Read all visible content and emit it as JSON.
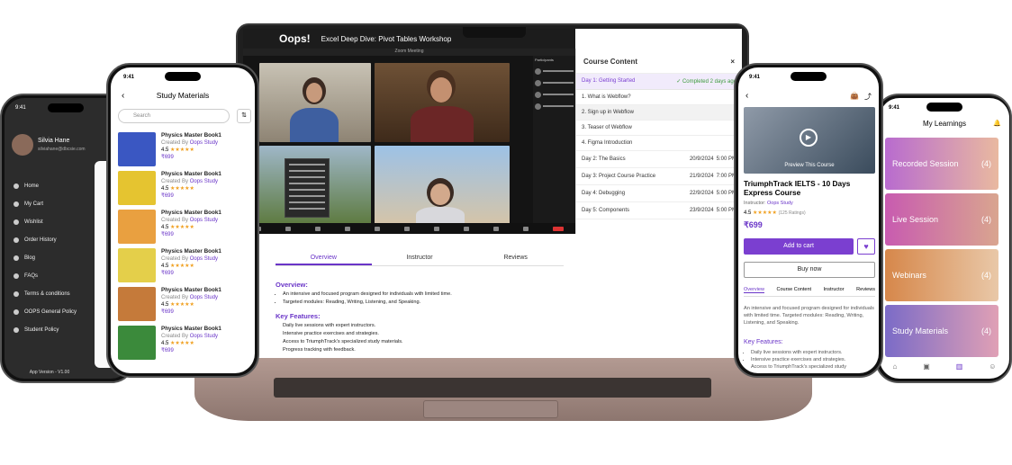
{
  "meeting": {
    "logo": "Oops!",
    "title": "Excel Deep Dive: Pivot Tables Workshop",
    "zoom_label": "Zoom Meeting",
    "participants_label": "Participants"
  },
  "course_content": {
    "title": "Course Content",
    "close": "×",
    "day1": "Day 1: Getting Started",
    "day1_status": "✓ Completed 2 days ago",
    "lessons": [
      "1. What is Webflow?",
      "2. Sign up in Webflow",
      "3. Teaser of Webflow",
      "4. Figma Introduction"
    ],
    "days": [
      {
        "name": "Day 2: The Basics",
        "date": "20/9/2024",
        "time": "5:00 PM"
      },
      {
        "name": "Day 3: Project Course Practice",
        "date": "21/9/2024",
        "time": "7:00 PM"
      },
      {
        "name": "Day 4: Debugging",
        "date": "22/9/2024",
        "time": "5:00 PM"
      },
      {
        "name": "Day 5: Components",
        "date": "23/9/2024",
        "time": "5:00 PM"
      }
    ]
  },
  "laptop_tabs": [
    "Overview",
    "Instructor",
    "Reviews"
  ],
  "overview": {
    "heading": "Overview:",
    "points": [
      "An intensive and focused program designed for individuals with limited time.",
      "Targeted modules: Reading, Writing, Listening, and Speaking."
    ],
    "features_heading": "Key Features:",
    "features": [
      "Daily live sessions with expert instructors.",
      "Intensive practice exercises and strategies.",
      "Access to TriumphTrack's specialized study materials.",
      "Progress tracking with feedback."
    ]
  },
  "menu_phone": {
    "time": "9:41",
    "user_name": "Silvia Hane",
    "user_email": "silviahane@dbcsie.com",
    "items": [
      "Home",
      "My Cart",
      "Wishlist",
      "Order History",
      "Blog",
      "FAQs",
      "Terms & conditions",
      "OOPS General Policy",
      "Student Policy"
    ],
    "version": "App Version - V1.00"
  },
  "study_phone": {
    "time": "9:41",
    "title": "Study Materials",
    "search_placeholder": "Search",
    "item_title": "Physics Master Book1",
    "created_by": "Created By",
    "creator": "Oops Study",
    "rating": "4.5",
    "stars": "★★★★★",
    "price": "₹699"
  },
  "product_phone": {
    "time": "9:41",
    "preview": "Preview This Course",
    "title": "TriumphTrack IELTS - 10 Days Express Course",
    "instructor_label": "Instructor:",
    "instructor": "Oops Study",
    "rating": "4.5",
    "stars": "★★★★★",
    "ratings_count": "(125 Ratings)",
    "price": "₹699",
    "add_to_cart": "Add to cart",
    "buy_now": "Buy now",
    "tabs": [
      "Overview",
      "Course Content",
      "Instructor",
      "Reviews"
    ],
    "desc": "An intensive and focused program designed for individuals with limited time. Targeted modules: Reading, Writing, Listening, and Speaking.",
    "features_heading": "Key Features:",
    "features": [
      "Daily live sessions with expert instructors.",
      "Intensive practice exercises and strategies.",
      "Access to TriumphTrack's specialized study"
    ]
  },
  "learnings_phone": {
    "time": "9:41",
    "title": "My Learnings",
    "cards": [
      {
        "label": "Recorded Session",
        "count": "(4)"
      },
      {
        "label": "Live Session",
        "count": "(4)"
      },
      {
        "label": "Webinars",
        "count": "(4)"
      },
      {
        "label": "Study Materials",
        "count": "(4)"
      }
    ]
  },
  "colors": {
    "accent": "#7b3fd0",
    "star": "#f0a020"
  }
}
